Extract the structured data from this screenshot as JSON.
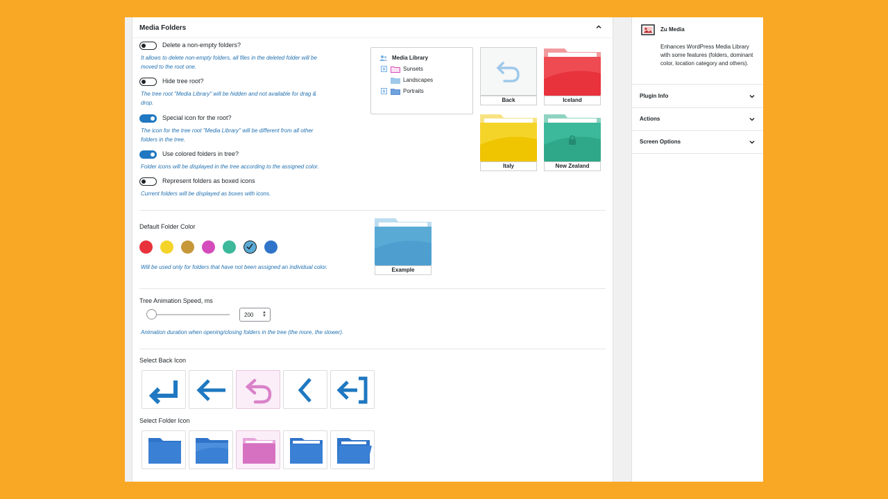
{
  "panel": {
    "title": "Media Folders",
    "options": [
      {
        "label": "Delete a non-empty folders?",
        "on": false,
        "desc": [
          "It allows to delete non-empty folders, all files in the deleted folder will be",
          "moved to the root one."
        ]
      },
      {
        "label": "Hide tree root?",
        "on": false,
        "desc": [
          "The tree root \"Media Library\" will be hidden and not available for drag &",
          "drop."
        ]
      },
      {
        "label": "Special icon for the root?",
        "on": true,
        "desc": [
          "The icon for the tree root \"Media Library\" will be different from all other",
          "folders in the tree."
        ]
      },
      {
        "label": "Use colored folders in tree?",
        "on": true,
        "desc": [
          "Folder icons will be displayed in the tree according to the assigned color."
        ]
      },
      {
        "label": "Represent folders as boxed icons",
        "on": false,
        "desc": [
          "Current folders will be displayed as boxes with icons."
        ]
      }
    ],
    "tree": {
      "root": "Media Library",
      "items": [
        "Sunsets",
        "Landscapes",
        "Portraits"
      ]
    },
    "preview_folders": {
      "back": "Back",
      "iceland": "Iceland",
      "italy": "Italy",
      "new_zealand": "New Zealand"
    },
    "default_color": {
      "label": "Default Folder Color",
      "colors": [
        "#e8323c",
        "#f5d42a",
        "#c6983a",
        "#d44bbb",
        "#3cb89b",
        "#5aaad6",
        "#2f74c9"
      ],
      "selected_index": 5,
      "desc": "Will be used only for folders that have not been assigned an individual color.",
      "example_label": "Example"
    },
    "animation": {
      "label": "Tree Animation Speed, ms",
      "value": "200",
      "desc": "Animation duration when opening/closing folders in the tree (the more, the slower)."
    },
    "back_icon": {
      "label": "Select Back Icon",
      "selected_index": 2
    },
    "folder_icon": {
      "label": "Select Folder Icon",
      "selected_index": 2
    }
  },
  "sidebar": {
    "plugin_name": "Zu Media",
    "description": "Enhances WordPress Media Library with some features (folders, dominant color, location category and others).",
    "sections": [
      "Plugin Info",
      "Actions",
      "Screen Options"
    ]
  },
  "icons": {
    "collapse": "chevron-up-icon",
    "expand": "chevron-down-icon",
    "plugin": "image-icon"
  }
}
